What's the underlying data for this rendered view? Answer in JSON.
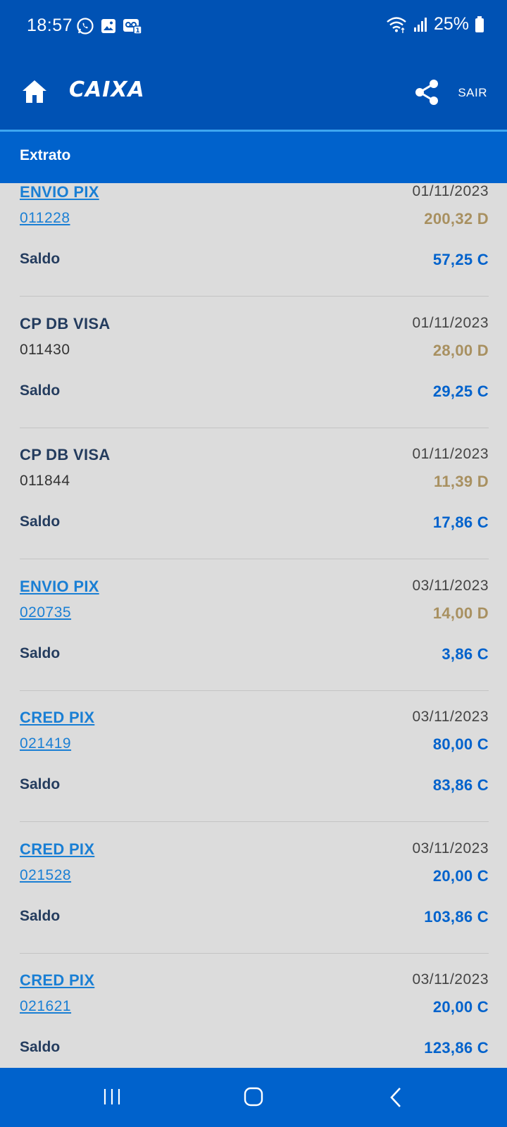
{
  "status_bar": {
    "time": "18:57",
    "battery": "25%",
    "icons_left": [
      "whatsapp-icon",
      "gallery-icon",
      "voicemail-icon"
    ],
    "icons_right": [
      "wifi-icon",
      "signal-icon",
      "battery-icon"
    ]
  },
  "header": {
    "logo": "CAIXA",
    "sair_label": "SAIR",
    "icons": [
      "home-icon",
      "share-icon"
    ]
  },
  "section": {
    "title": "Extrato"
  },
  "entries": [
    {
      "title": "ENVIO PIX",
      "doc": "011228",
      "date": "01/11/2023",
      "amount": "200,32 D",
      "amount_type": "debit",
      "saldo_label": "Saldo",
      "saldo": "57,25 C",
      "is_link": true
    },
    {
      "title": "CP DB VISA",
      "doc": "011430",
      "date": "01/11/2023",
      "amount": "28,00 D",
      "amount_type": "debit",
      "saldo_label": "Saldo",
      "saldo": "29,25 C",
      "is_link": false
    },
    {
      "title": "CP DB VISA",
      "doc": "011844",
      "date": "01/11/2023",
      "amount": "11,39 D",
      "amount_type": "debit",
      "saldo_label": "Saldo",
      "saldo": "17,86 C",
      "is_link": false
    },
    {
      "title": "ENVIO PIX",
      "doc": "020735",
      "date": "03/11/2023",
      "amount": "14,00 D",
      "amount_type": "debit",
      "saldo_label": "Saldo",
      "saldo": "3,86 C",
      "is_link": true
    },
    {
      "title": "CRED PIX",
      "doc": "021419",
      "date": "03/11/2023",
      "amount": "80,00 C",
      "amount_type": "credit",
      "saldo_label": "Saldo",
      "saldo": "83,86 C",
      "is_link": true
    },
    {
      "title": "CRED PIX",
      "doc": "021528",
      "date": "03/11/2023",
      "amount": "20,00 C",
      "amount_type": "credit",
      "saldo_label": "Saldo",
      "saldo": "103,86 C",
      "is_link": true
    },
    {
      "title": "CRED PIX",
      "doc": "021621",
      "date": "03/11/2023",
      "amount": "20,00 C",
      "amount_type": "credit",
      "saldo_label": "Saldo",
      "saldo": "123,86 C",
      "is_link": true
    }
  ],
  "nav_bar": {
    "icons": [
      "recent-apps-icon",
      "home-nav-icon",
      "back-icon"
    ]
  },
  "colors": {
    "header_bg": "#0052b4",
    "section_bg": "#0062cc",
    "link": "#1a7fd4",
    "debit": "#a89060",
    "credit": "#0062cc",
    "text_dark": "#243c5e",
    "list_bg": "#dcdcdc"
  }
}
